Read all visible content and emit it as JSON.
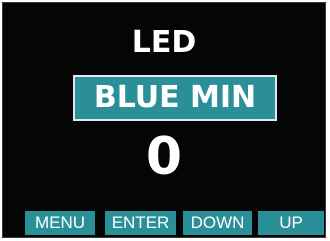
{
  "screen": {
    "title": "LED",
    "parameter_label": "BLUE MIN",
    "value": "0"
  },
  "softkeys": {
    "menu": "MENU",
    "enter": "ENTER",
    "down": "DOWN",
    "up": "UP"
  },
  "colors": {
    "background": "#050505",
    "accent": "#2b8f97",
    "text": "#ffffff"
  }
}
